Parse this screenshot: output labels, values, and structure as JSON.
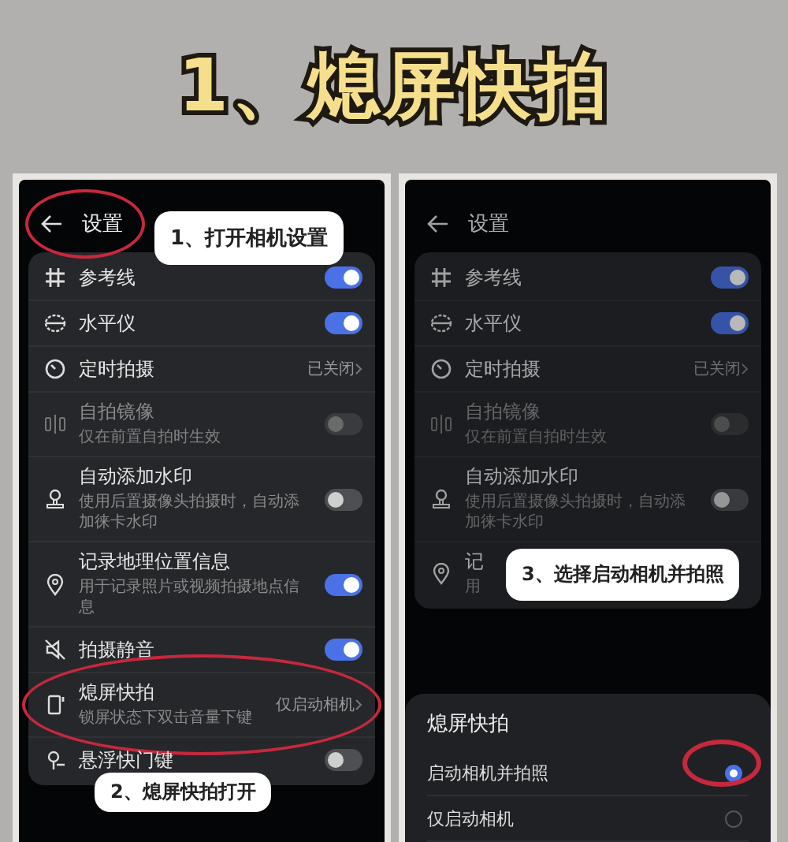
{
  "title": "1、熄屏快拍",
  "screens": [
    {
      "header": {
        "title": "设置",
        "circled": true
      },
      "dimmed": false,
      "callouts": [
        {
          "text": "1、打开相机设置"
        },
        {
          "text": "2、熄屏快拍打开"
        }
      ],
      "rows": [
        {
          "title": "参考线",
          "kind": "toggle",
          "on": true,
          "disabled": false,
          "circled": false
        },
        {
          "title": "水平仪",
          "kind": "toggle",
          "on": true,
          "disabled": false,
          "circled": false
        },
        {
          "title": "定时拍摄",
          "kind": "value",
          "value": "已关闭",
          "disabled": false,
          "circled": false
        },
        {
          "title": "自拍镜像",
          "subtitle": "仅在前置自拍时生效",
          "kind": "toggle",
          "on": false,
          "disabled": true,
          "circled": false
        },
        {
          "title": "自动添加水印",
          "subtitle": "使用后置摄像头拍摄时，自动添加徕卡水印",
          "kind": "toggle",
          "on": false,
          "disabled": false,
          "circled": false
        },
        {
          "title": "记录地理位置信息",
          "subtitle": "用于记录照片或视频拍摄地点信息",
          "kind": "toggle",
          "on": true,
          "disabled": false,
          "circled": false
        },
        {
          "title": "拍摄静音",
          "kind": "toggle",
          "on": true,
          "disabled": false,
          "circled": false
        },
        {
          "title": "熄屏快拍",
          "subtitle": "锁屏状态下双击音量下键",
          "kind": "value",
          "value": "仅启动相机",
          "disabled": false,
          "circled": true
        },
        {
          "title": "悬浮快门键",
          "kind": "toggle",
          "on": false,
          "disabled": false,
          "circled": false
        }
      ]
    },
    {
      "header": {
        "title": "设置",
        "circled": false
      },
      "dimmed": true,
      "callouts": [
        {
          "text": "3、选择启动相机并拍照"
        }
      ],
      "rows": [
        {
          "title": "参考线",
          "kind": "toggle",
          "on": true,
          "disabled": false,
          "circled": false
        },
        {
          "title": "水平仪",
          "kind": "toggle",
          "on": true,
          "disabled": false,
          "circled": false
        },
        {
          "title": "定时拍摄",
          "kind": "value",
          "value": "已关闭",
          "disabled": false,
          "circled": false
        },
        {
          "title": "自拍镜像",
          "subtitle": "仅在前置自拍时生效",
          "kind": "toggle",
          "on": false,
          "disabled": true,
          "circled": false
        },
        {
          "title": "自动添加水印",
          "subtitle": "使用后置摄像头拍摄时，自动添加徕卡水印",
          "kind": "toggle",
          "on": false,
          "disabled": false,
          "circled": false
        },
        {
          "title": "记",
          "subtitle": "用",
          "kind": "plain",
          "disabled": false,
          "circled": false
        }
      ],
      "sheet": {
        "title": "熄屏快拍",
        "options": [
          {
            "label": "启动相机并拍照",
            "selected": true,
            "circled": true
          },
          {
            "label": "仅启动相机",
            "selected": false,
            "circled": false
          }
        ]
      }
    }
  ]
}
